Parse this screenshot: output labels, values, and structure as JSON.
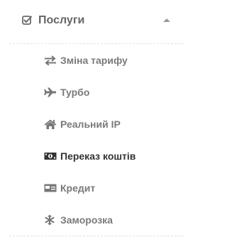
{
  "menu": {
    "header": {
      "label": "Послуги",
      "icon": "check-square-icon",
      "expanded": true
    },
    "items": [
      {
        "label": "Зміна тарифу",
        "icon": "exchange-icon",
        "active": false
      },
      {
        "label": "Турбо",
        "icon": "plane-icon",
        "active": false
      },
      {
        "label": "Реальний IP",
        "icon": "home-icon",
        "active": false
      },
      {
        "label": "Переказ коштів",
        "icon": "money-icon",
        "active": true
      },
      {
        "label": "Кредит",
        "icon": "credit-card-icon",
        "active": false
      },
      {
        "label": "Заморозка",
        "icon": "snowflake-icon",
        "active": false
      }
    ]
  },
  "colors": {
    "text_muted": "#7a7a7a",
    "text_active": "#333333",
    "header_text": "#666666",
    "divider": "#e2e2e2"
  }
}
